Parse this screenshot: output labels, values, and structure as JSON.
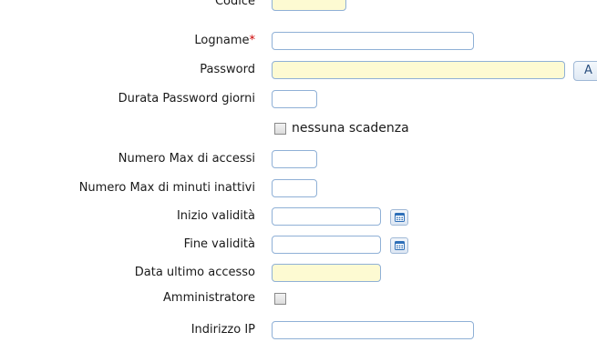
{
  "form": {
    "codice": {
      "label": "Codice",
      "value": ""
    },
    "logname": {
      "label": "Logname",
      "required_mark": "*",
      "value": ""
    },
    "password": {
      "label": "Password",
      "value": "",
      "side_button_label": "A"
    },
    "durata_password": {
      "label": "Durata Password giorni",
      "value": ""
    },
    "nessuna_scadenza": {
      "label": "nessuna scadenza",
      "checked": false
    },
    "numero_max_accessi": {
      "label": "Numero Max di accessi",
      "value": ""
    },
    "numero_max_minuti": {
      "label": "Numero Max di minuti inattivi",
      "value": ""
    },
    "inizio_validita": {
      "label": "Inizio validità",
      "value": ""
    },
    "fine_validita": {
      "label": "Fine validità",
      "value": ""
    },
    "data_ultimo_accesso": {
      "label": "Data ultimo accesso",
      "value": ""
    },
    "amministratore": {
      "label": "Amministratore",
      "checked": false
    },
    "indirizzo_ip": {
      "label": "Indirizzo IP",
      "value": ""
    }
  },
  "colors": {
    "required": "#cc0000",
    "field_border": "#8fb0d6",
    "field_highlight": "#fdfad2"
  },
  "icons": {
    "calendar": "calendar-icon"
  }
}
